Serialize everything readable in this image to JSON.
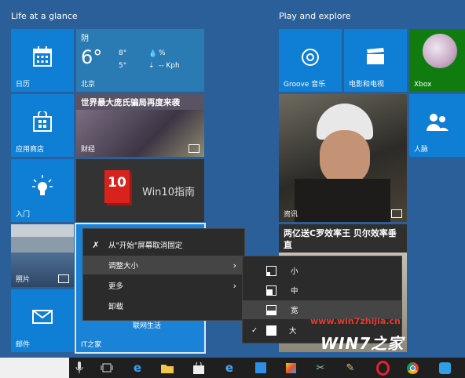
{
  "groups": {
    "left": "Life at a glance",
    "right": "Play and explore"
  },
  "tiles": {
    "calendar": "日历",
    "weather": {
      "condition": "阴",
      "temp": "6°",
      "high": "8°",
      "low": "5°",
      "humidity": "%",
      "wind": "-- Kph",
      "city": "北京"
    },
    "finance": {
      "headline": "世界最大庞氏骗局再度来袭",
      "label": "财经"
    },
    "store": "应用商店",
    "win10": {
      "badge": "10",
      "title": "Win10指南"
    },
    "tips": "入门",
    "photos": "照片",
    "mail": "邮件",
    "ithome": {
      "label": "IT之家",
      "sub": "联网生活"
    },
    "groove": "Groove 音乐",
    "movies": "电影和电视",
    "xbox": "Xbox",
    "news": {
      "label": "资讯"
    },
    "people": "人脉",
    "sports": {
      "headline": "两亿送C罗效率王 贝尔效率垂直"
    }
  },
  "context_menu": {
    "unpin": "从\"开始\"屏幕取消固定",
    "resize": "调整大小",
    "more": "更多",
    "uninstall": "卸载"
  },
  "size_menu": {
    "small": "小",
    "medium": "中",
    "wide": "宽",
    "large": "大"
  },
  "watermark": {
    "url": "www.win7zhijia.cn",
    "logo": "WIN7之家"
  },
  "colors": {
    "tile": "#0f7fd6",
    "background": "#2b5f99",
    "menu": "#2b2b2b",
    "taskbar": "#1f1f1f"
  }
}
